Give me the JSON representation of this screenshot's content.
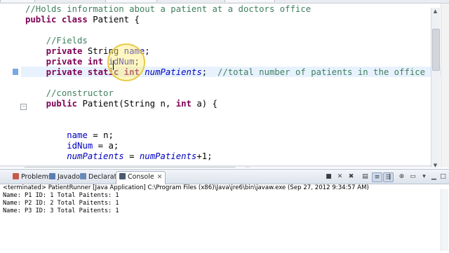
{
  "editor": {
    "lines": [
      {
        "parts": [
          {
            "t": "//Holds information about a patient at a doctors office",
            "c": "comment"
          }
        ]
      },
      {
        "parts": [
          {
            "t": "public class ",
            "c": "kw"
          },
          {
            "t": "Patient {",
            "c": ""
          }
        ]
      },
      {
        "parts": []
      },
      {
        "parts": [
          {
            "t": "    //Fields",
            "c": "comment"
          }
        ]
      },
      {
        "parts": [
          {
            "t": "    private ",
            "c": "kw"
          },
          {
            "t": "String ",
            "c": ""
          },
          {
            "t": "name",
            "c": "field"
          },
          {
            "t": ";",
            "c": ""
          }
        ]
      },
      {
        "parts": [
          {
            "t": "    private int ",
            "c": "kw"
          },
          {
            "t": "idNum",
            "c": "field"
          },
          {
            "t": ";",
            "c": ""
          }
        ]
      },
      {
        "parts": [
          {
            "t": "    private static int ",
            "c": "kw"
          },
          {
            "t": "numPatients",
            "c": "ital"
          },
          {
            "t": ";  ",
            "c": ""
          },
          {
            "t": "//total number of patients in the office",
            "c": "comment"
          }
        ]
      },
      {
        "parts": []
      },
      {
        "parts": [
          {
            "t": "    //constructor",
            "c": "comment"
          }
        ]
      },
      {
        "parts": [
          {
            "t": "    public ",
            "c": "kw"
          },
          {
            "t": "Patient(String n, ",
            "c": ""
          },
          {
            "t": "int ",
            "c": "kw"
          },
          {
            "t": "a) {",
            "c": ""
          }
        ]
      },
      {
        "parts": []
      },
      {
        "parts": []
      },
      {
        "parts": [
          {
            "t": "        ",
            "c": ""
          },
          {
            "t": "name",
            "c": "field"
          },
          {
            "t": " = n;",
            "c": ""
          }
        ]
      },
      {
        "parts": [
          {
            "t": "        ",
            "c": ""
          },
          {
            "t": "idNum",
            "c": "field"
          },
          {
            "t": " = a;",
            "c": ""
          }
        ]
      },
      {
        "parts": [
          {
            "t": "        ",
            "c": ""
          },
          {
            "t": "numPatients",
            "c": "ital"
          },
          {
            "t": " = ",
            "c": ""
          },
          {
            "t": "numPatients",
            "c": "ital"
          },
          {
            "t": "+1;",
            "c": ""
          }
        ]
      }
    ]
  },
  "panel": {
    "tabs": [
      {
        "label": "Problems",
        "icon": "problems-icon",
        "color": "#c65a4a"
      },
      {
        "label": "Javadoc",
        "icon": "javadoc-icon",
        "color": "#5b7fb5"
      },
      {
        "label": "Declaration",
        "icon": "declaration-icon",
        "color": "#6a8bb8"
      },
      {
        "label": "Console",
        "icon": "console-icon",
        "color": "#4a5a70"
      }
    ],
    "terminated_text": "<terminated> PatientRunner [Java Application] C:\\Program Files (x86)\\Java\\jre6\\bin\\javaw.exe (Sep 27, 2012 9:34:57 AM)",
    "output": [
      "Name: P1 ID: 1 Total Paitents: 1",
      "Name: P2 ID: 2 Total Paitents: 1",
      "Name: P3 ID: 3 Total Paitents: 1"
    ]
  },
  "colors": {
    "keyword": "#7f0055",
    "comment": "#3f7f5f",
    "field": "#0000c0",
    "current_line": "#e8f2fe"
  }
}
